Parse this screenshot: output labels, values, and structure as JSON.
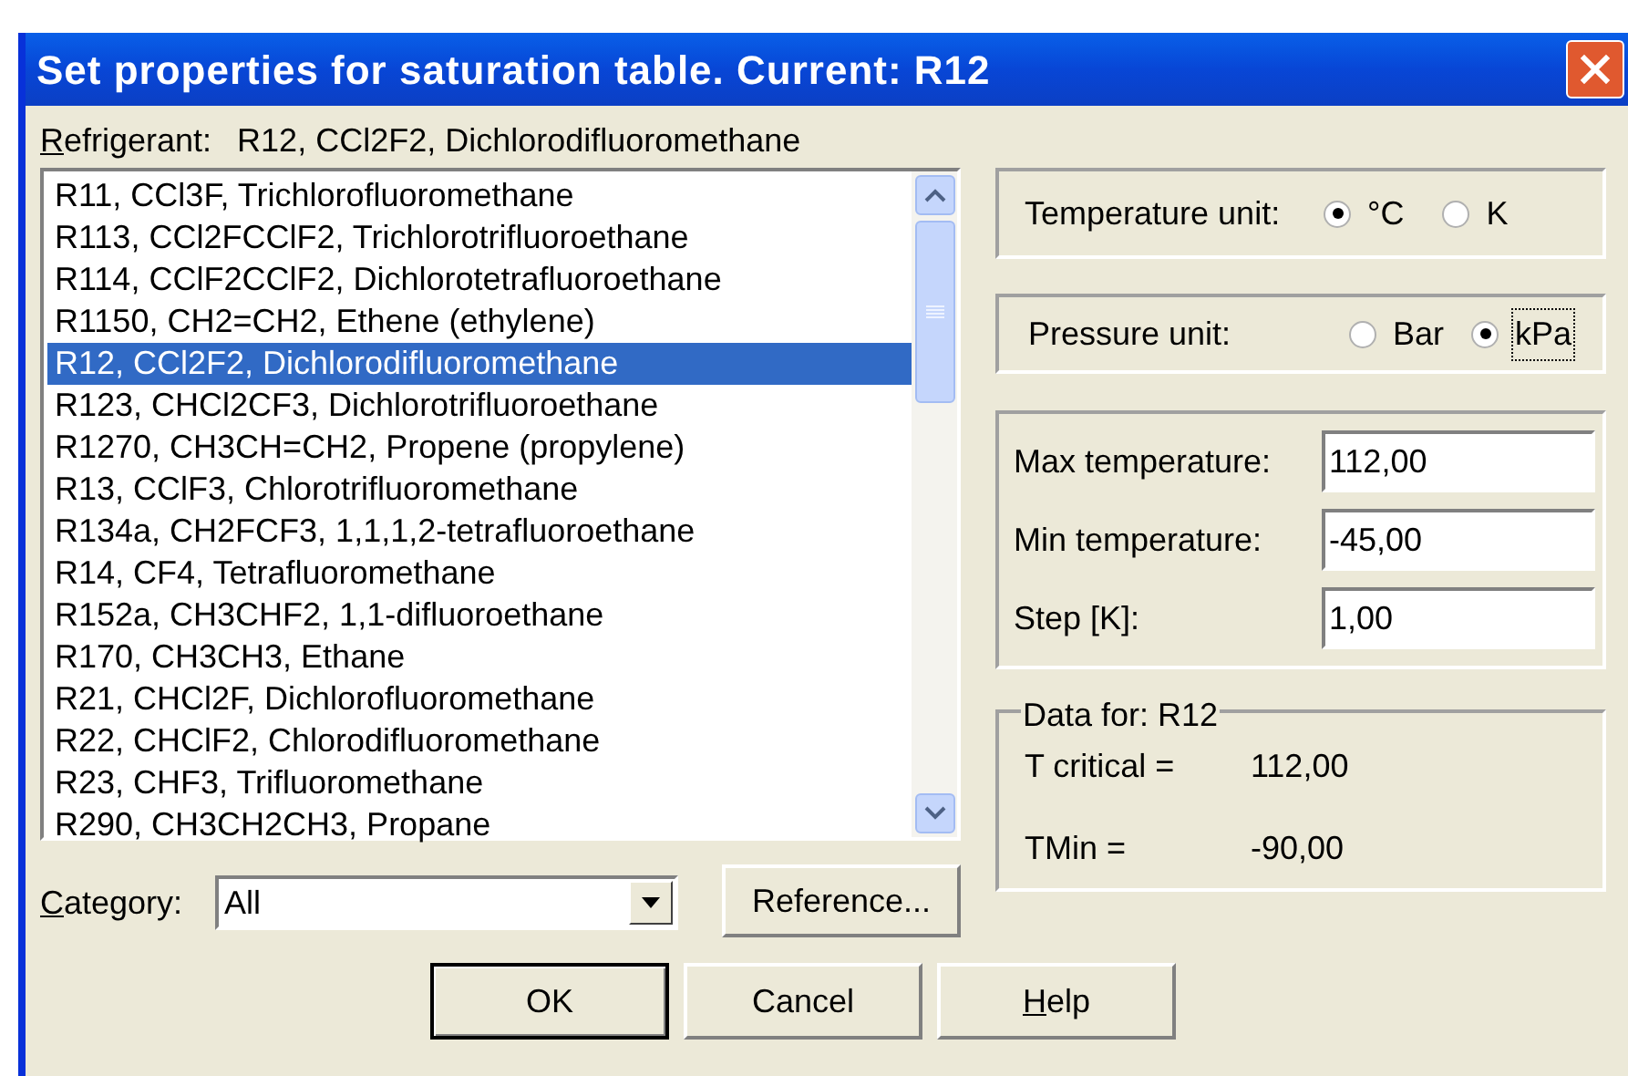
{
  "window": {
    "title": "Set properties for saturation table. Current: R12"
  },
  "refrigerant": {
    "label": "Refrigerant:",
    "underline_first": true,
    "value": "R12, CCl2F2, Dichlorodifluoromethane"
  },
  "refrigerant_list": [
    {
      "text": "R11, CCl3F, Trichlorofluoromethane",
      "selected": false
    },
    {
      "text": "R113, CCl2FCClF2, Trichlorotrifluoroethane",
      "selected": false
    },
    {
      "text": "R114, CClF2CClF2, Dichlorotetrafluoroethane",
      "selected": false
    },
    {
      "text": "R1150, CH2=CH2, Ethene (ethylene)",
      "selected": false
    },
    {
      "text": "R12, CCl2F2, Dichlorodifluoromethane",
      "selected": true
    },
    {
      "text": "R123, CHCl2CF3, Dichlorotrifluoroethane",
      "selected": false
    },
    {
      "text": "R1270, CH3CH=CH2, Propene (propylene)",
      "selected": false
    },
    {
      "text": "R13, CClF3, Chlorotrifluoromethane",
      "selected": false
    },
    {
      "text": "R134a, CH2FCF3, 1,1,1,2-tetrafluoroethane",
      "selected": false
    },
    {
      "text": "R14, CF4, Tetrafluoromethane",
      "selected": false
    },
    {
      "text": "R152a, CH3CHF2, 1,1-difluoroethane",
      "selected": false
    },
    {
      "text": "R170, CH3CH3, Ethane",
      "selected": false
    },
    {
      "text": "R21, CHCl2F, Dichlorofluoromethane",
      "selected": false
    },
    {
      "text": "R22, CHClF2, Chlorodifluoromethane",
      "selected": false
    },
    {
      "text": "R23, CHF3, Trifluoromethane",
      "selected": false
    },
    {
      "text": "R290, CH3CH2CH3, Propane",
      "selected": false
    }
  ],
  "category": {
    "label": "Category:",
    "underline_first": true,
    "value": "All"
  },
  "reference_button": "Reference...",
  "temperature_unit": {
    "label": "Temperature unit:",
    "options": [
      {
        "label": "°C",
        "selected": true,
        "focused": false
      },
      {
        "label": "K",
        "selected": false,
        "focused": false
      }
    ]
  },
  "pressure_unit": {
    "label": "Pressure unit:",
    "options": [
      {
        "label": "Bar",
        "selected": false,
        "focused": false
      },
      {
        "label": "kPa",
        "selected": true,
        "focused": true
      }
    ]
  },
  "fields": [
    {
      "label": "Max temperature:",
      "value": "112,00"
    },
    {
      "label": "Min temperature:",
      "value": "-45,00"
    },
    {
      "label": "Step [K]:",
      "value": "1,00"
    }
  ],
  "data_group": {
    "title": "Data for: R12",
    "rows": [
      {
        "label": "T critical =",
        "value": "112,00"
      },
      {
        "label": "TMin =",
        "value": "-90,00"
      }
    ]
  },
  "buttons": [
    {
      "label": "OK",
      "default": true,
      "underline_first": false
    },
    {
      "label": "Cancel",
      "default": false,
      "underline_first": false
    },
    {
      "label": "Help",
      "default": false,
      "underline_first": true
    }
  ]
}
